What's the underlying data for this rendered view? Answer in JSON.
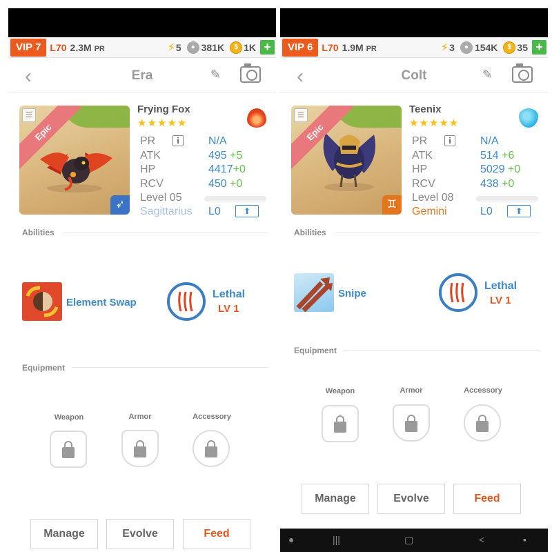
{
  "panels": [
    {
      "status": {
        "vip": "VIP 7",
        "level": "L70",
        "power": "2.3M",
        "power_suffix": "PR",
        "energy": "5",
        "paw": "381K",
        "coins": "1K",
        "plus": "+"
      },
      "nav_title": "Era",
      "monster": {
        "name": "Frying Fox",
        "stars": "★★★★★",
        "rarity": "Epic",
        "element": "fire",
        "stats": [
          {
            "label": "PR",
            "value": "N/A",
            "bonus": ""
          },
          {
            "label": "ATK",
            "value": "495",
            "bonus": "+5"
          },
          {
            "label": "HP",
            "value": "4417",
            "bonus": "+0"
          },
          {
            "label": "RCV",
            "value": "450",
            "bonus": "+0"
          }
        ],
        "level": "Level 05",
        "zodiac": "Sagittarius",
        "zodiac_color": "#a9c4e2",
        "zodiac_level": "L0",
        "zodiac_icon": "arrow-icon"
      },
      "abilities_label": "Abilities",
      "active": {
        "name": "Element Swap",
        "icon": "element-swap-icon"
      },
      "passive": {
        "name": "Lethal",
        "level": "LV 1"
      },
      "equipment_label": "Equipment",
      "slots": [
        "Weapon",
        "Armor",
        "Accessory"
      ],
      "buttons": {
        "manage": "Manage",
        "evolve": "Evolve",
        "feed": "Feed"
      }
    },
    {
      "status": {
        "vip": "VIP 6",
        "level": "L70",
        "power": "1.9M",
        "power_suffix": "PR",
        "energy": "3",
        "paw": "154K",
        "coins": "35",
        "plus": "+"
      },
      "nav_title": "Colt",
      "monster": {
        "name": "Teenix",
        "stars": "★★★★★",
        "rarity": "Epic",
        "element": "water",
        "stats": [
          {
            "label": "PR",
            "value": "N/A",
            "bonus": ""
          },
          {
            "label": "ATK",
            "value": "514",
            "bonus": "+6"
          },
          {
            "label": "HP",
            "value": "5029",
            "bonus": "+0"
          },
          {
            "label": "RCV",
            "value": "438",
            "bonus": "+0"
          }
        ],
        "level": "Level 08",
        "zodiac": "Gemini",
        "zodiac_color": "#e4751f",
        "zodiac_level": "L0",
        "zodiac_icon": "gemini-icon"
      },
      "abilities_label": "Abilities",
      "active": {
        "name": "Snipe",
        "icon": "snipe-icon"
      },
      "passive": {
        "name": "Lethal",
        "level": "LV 1"
      },
      "equipment_label": "Equipment",
      "slots": [
        "Weapon",
        "Armor",
        "Accessory"
      ],
      "buttons": {
        "manage": "Manage",
        "evolve": "Evolve",
        "feed": "Feed"
      }
    }
  ]
}
